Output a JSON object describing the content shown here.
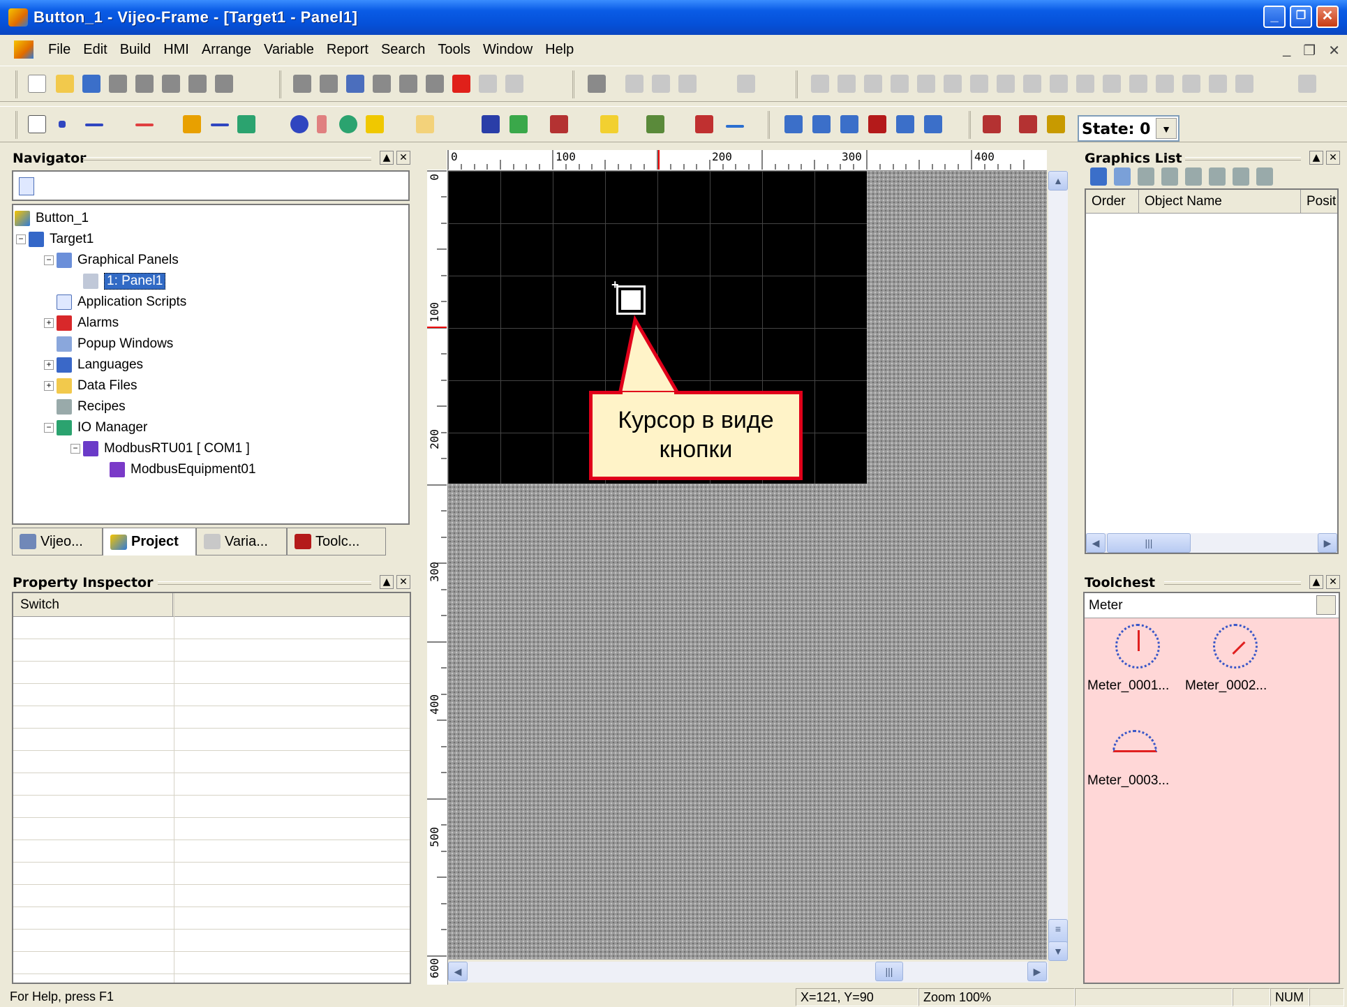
{
  "window": {
    "title": "Button_1 - Vijeo-Frame - [Target1 - Panel1]",
    "controls": {
      "minimize": "_",
      "restore": "❐",
      "close": "✕"
    }
  },
  "menu": {
    "items": [
      "File",
      "Edit",
      "Build",
      "HMI",
      "Arrange",
      "Variable",
      "Report",
      "Search",
      "Tools",
      "Window",
      "Help"
    ],
    "mdi_controls": [
      "_",
      "❐",
      "✕"
    ]
  },
  "toolbar": {
    "state_label": "State: 0"
  },
  "navigator": {
    "title": "Navigator",
    "tree": [
      {
        "label": "Button_1"
      },
      {
        "label": "Target1"
      },
      {
        "label": "Graphical Panels"
      },
      {
        "label": "1: Panel1",
        "selected": true
      },
      {
        "label": "Application Scripts"
      },
      {
        "label": "Alarms"
      },
      {
        "label": "Popup Windows"
      },
      {
        "label": "Languages"
      },
      {
        "label": "Data Files"
      },
      {
        "label": "Recipes"
      },
      {
        "label": "IO Manager"
      },
      {
        "label": "ModbusRTU01 [ COM1 ]"
      },
      {
        "label": "ModbusEquipment01"
      }
    ],
    "tabs": [
      "Vijeo...",
      "Project",
      "Varia...",
      "Toolc..."
    ]
  },
  "property_inspector": {
    "title": "Property Inspector",
    "column": "Switch"
  },
  "canvas": {
    "ruler_h": [
      "0",
      "100",
      "200",
      "300",
      "400"
    ],
    "ruler_v": [
      "0",
      "100",
      "200",
      "300",
      "400",
      "500",
      "600"
    ],
    "callout_text": "Курсор в виде кнопки"
  },
  "graphics_list": {
    "title": "Graphics List",
    "columns": [
      "Order",
      "Object Name",
      "Posit"
    ]
  },
  "toolchest": {
    "title": "Toolchest",
    "category": "Meter",
    "items": [
      "Meter_0001...",
      "Meter_0002...",
      "Meter_0003..."
    ]
  },
  "status": {
    "help": "For Help, press F1",
    "coords": "X=121, Y=90",
    "zoom": "Zoom 100%",
    "num": "NUM"
  },
  "colors": {
    "title_bar": "#0a5ce6",
    "panel_bg": "#000000",
    "toolchest_bg": "#ffd7d7",
    "callout_border": "#e0001a",
    "callout_bg": "#fff3c8",
    "selection": "#316ac5"
  }
}
